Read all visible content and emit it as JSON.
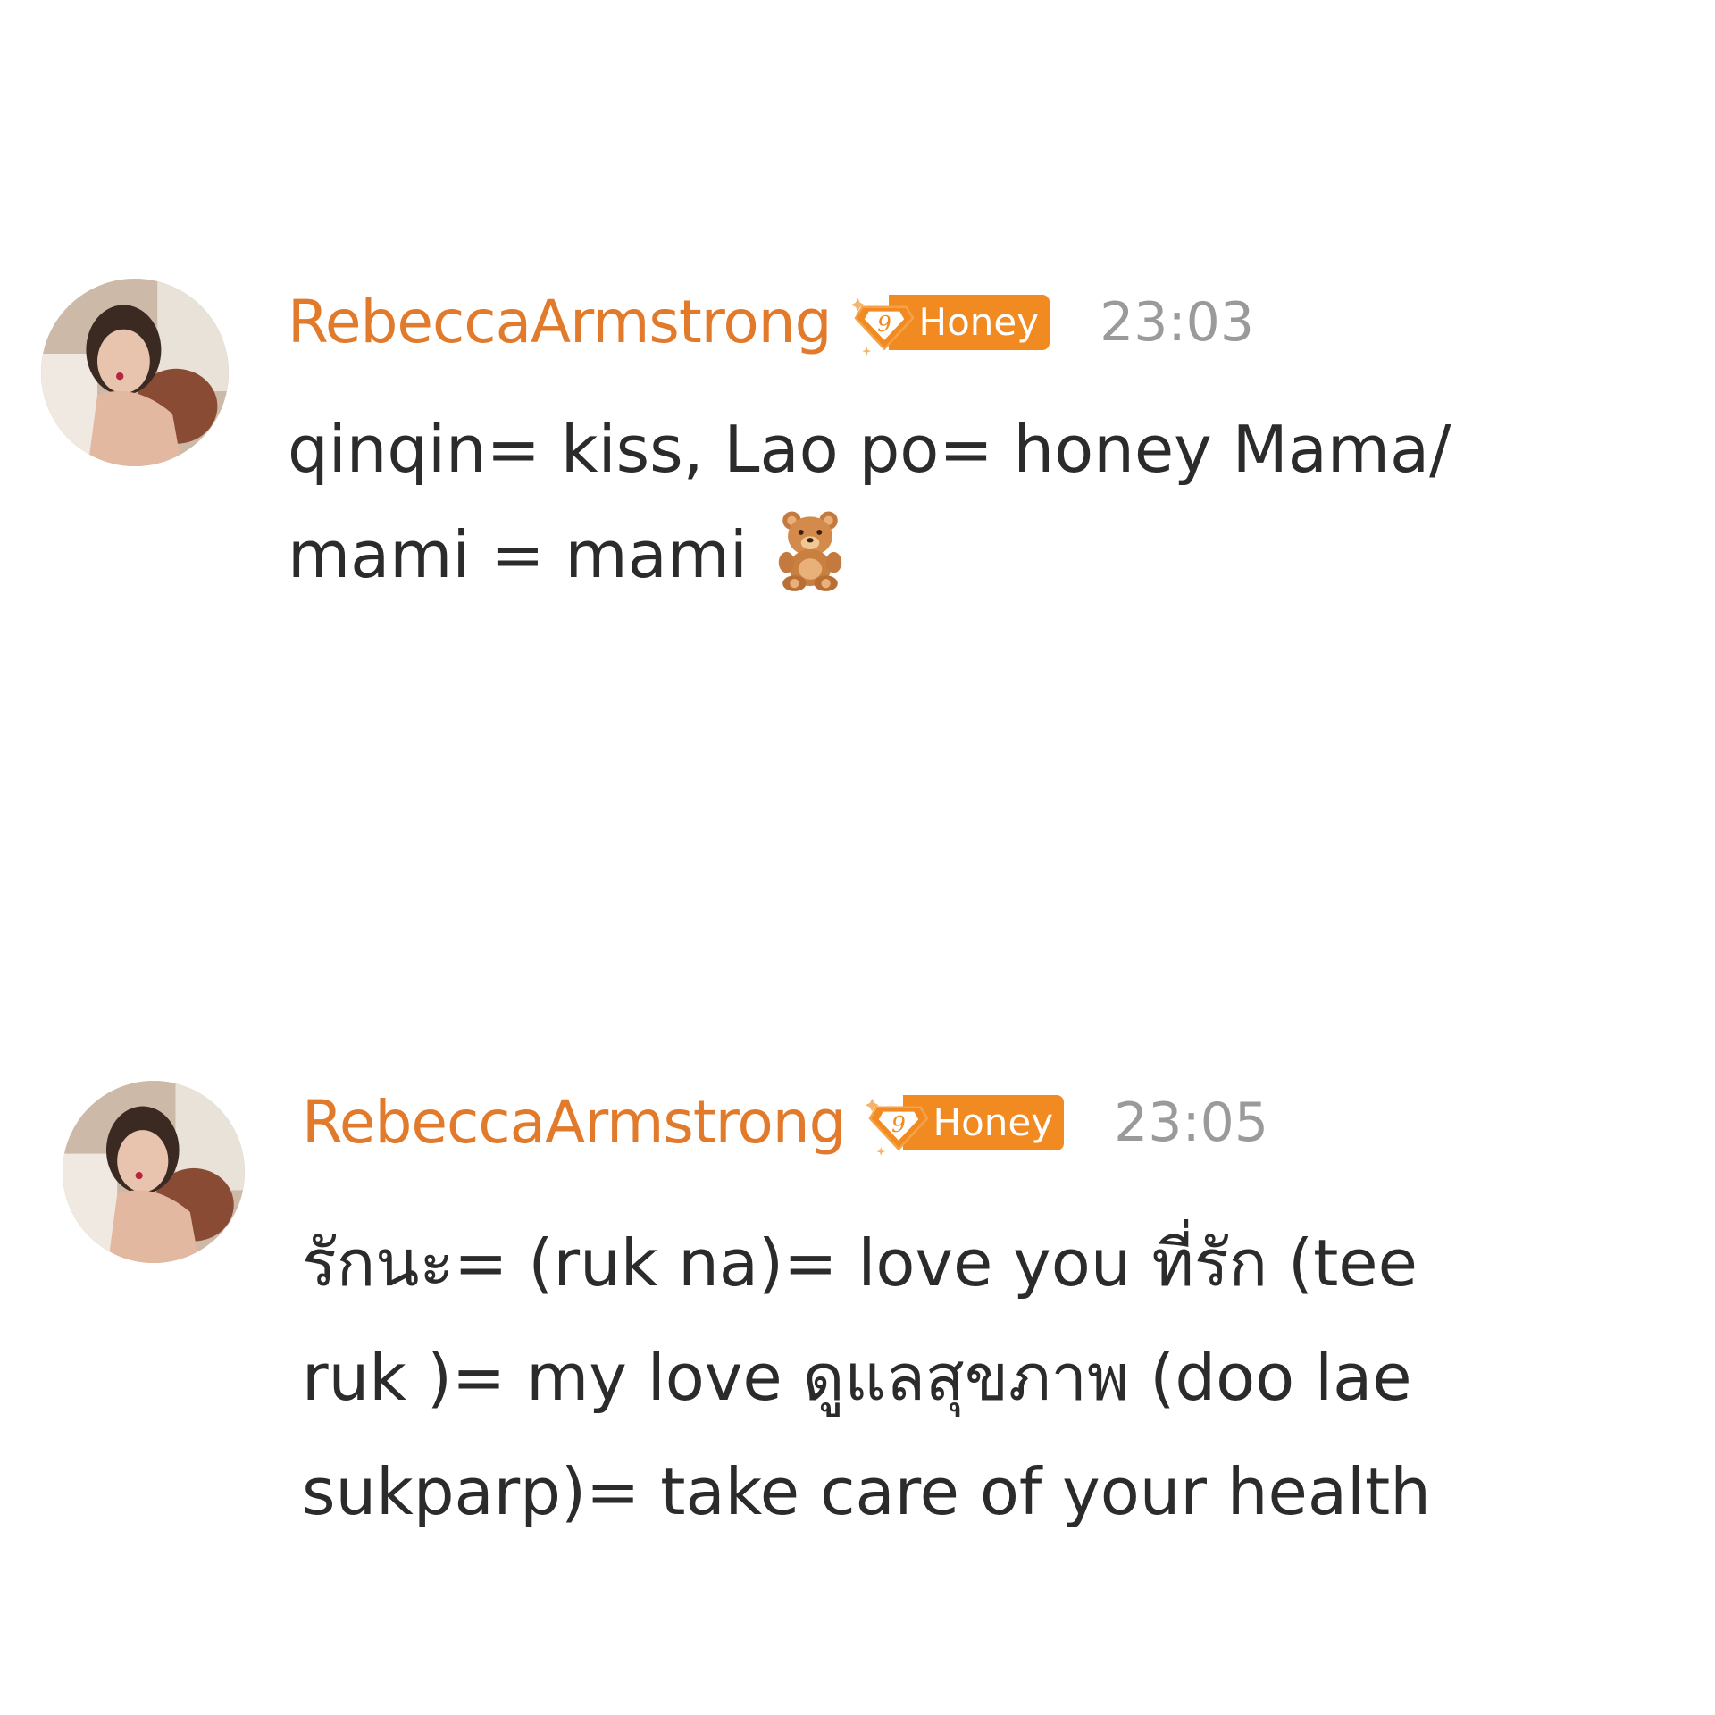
{
  "messages": [
    {
      "username": "RebeccaArmstrong",
      "badge_level": "9",
      "badge_label": "Honey",
      "time": "23:03",
      "text_line1": "qinqin= kiss, Lao po= honey Mama/",
      "text_line2": "mami = mami",
      "emoji": "teddy-bear-emoji"
    },
    {
      "username": "RebeccaArmstrong",
      "badge_level": "9",
      "badge_label": "Honey",
      "time": "23:05",
      "text_line1": "รักนะ= (ruk na)= love you ที่รัก (tee",
      "text_line2": "ruk )= my love ดูแลสุขภาพ (doo lae",
      "text_line3": "sukparp)= take care of your health"
    }
  ],
  "colors": {
    "username": "#e17a2a",
    "badge": "#f08a21",
    "timestamp": "#9a9a9a",
    "text": "#2b2b2b"
  }
}
